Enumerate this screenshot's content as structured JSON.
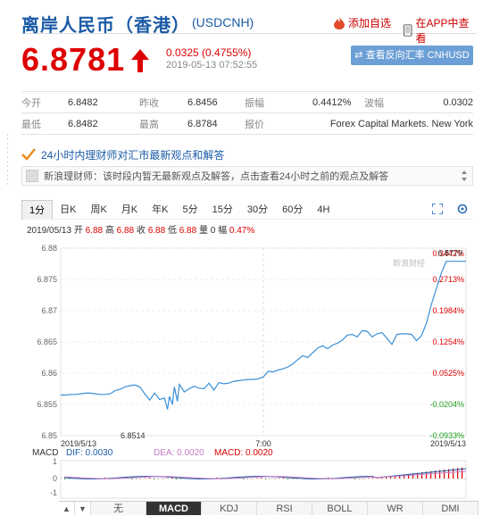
{
  "header": {
    "title": "离岸人民币（香港）",
    "symbol": "(USDCNH)",
    "add_watch": "添加自选",
    "view_in_app": "在APP中查看"
  },
  "quote": {
    "price": "6.8781",
    "change": "0.0325 (0.4755%)",
    "timestamp": "2019-05-13 07:52:55",
    "reverse_button": "查看反向汇率 CNHUSD",
    "up_color": "#dd0000"
  },
  "stats": {
    "row1": [
      {
        "label": "今开",
        "value": "6.8482"
      },
      {
        "label": "昨收",
        "value": "6.8456"
      },
      {
        "label": "振幅",
        "value": "0.4412%"
      },
      {
        "label": "波幅",
        "value": "0.0302"
      }
    ],
    "row2": [
      {
        "label": "最低",
        "value": "6.8482"
      },
      {
        "label": "最高",
        "value": "6.8784"
      },
      {
        "label": "报价",
        "value": "Forex Capital Markets. New York"
      }
    ]
  },
  "advice": {
    "text": "24小时内理财师对汇市最新观点和解答"
  },
  "news": {
    "text": "新浪理财师：该时段内暂无最新观点及解答，点击查看24小时之前的观点及解答"
  },
  "tabs": [
    "1分",
    "日K",
    "周K",
    "月K",
    "年K",
    "5分",
    "15分",
    "30分",
    "60分",
    "4H"
  ],
  "active_tab": "1分",
  "ohlc": {
    "date": "2019/05/13",
    "open_label": "开",
    "open": "6.88",
    "high_label": "高",
    "high": "6.88",
    "close_label": "收",
    "close": "6.88",
    "low_label": "低",
    "low": "6.88",
    "vol_label": "量",
    "vol": "0",
    "amp_label": "幅",
    "amp": "0.47%"
  },
  "watermark": "新浪财经",
  "chart_data": {
    "type": "line",
    "title": "",
    "y_ticks": [
      "6.88",
      "6.875",
      "6.87",
      "6.865",
      "6.86",
      "6.855",
      "6.85"
    ],
    "pct_ticks": [
      "0.3442%",
      "0.2713%",
      "0.1984%",
      "0.1254%",
      "0.0525%",
      "-0.0204%",
      "-0.0933%"
    ],
    "ylim": [
      6.85,
      6.88
    ],
    "x_labels": [
      "2019/5/13",
      "7:00",
      "2019/5/13"
    ],
    "max_label": "6.8779",
    "min_label": "6.8514",
    "series": [
      {
        "color": "#3b8fd6",
        "x": [
          0,
          5,
          10,
          15,
          20,
          25,
          30,
          35,
          40,
          45,
          50,
          55,
          60,
          65,
          70,
          75,
          80,
          85,
          90,
          95,
          100,
          105,
          108,
          110,
          113,
          115,
          118,
          120,
          125,
          130,
          135,
          140,
          145,
          150,
          155,
          160,
          165,
          170,
          175,
          180,
          185,
          190,
          195,
          200,
          205,
          210,
          215,
          220,
          225,
          230,
          235,
          240,
          245,
          250,
          255,
          260,
          265,
          270,
          275,
          280,
          285,
          290,
          295,
          300,
          305,
          310,
          315,
          320,
          325,
          330,
          335,
          340,
          345,
          350,
          355,
          360,
          365,
          370,
          375,
          380,
          385,
          390,
          395,
          400,
          405,
          410
        ],
        "y": [
          6.8565,
          6.8565,
          6.8566,
          6.8566,
          6.8567,
          6.8568,
          6.8568,
          6.8567,
          6.8566,
          6.8566,
          6.8567,
          6.8572,
          6.8574,
          6.8578,
          6.858,
          6.8581,
          6.8578,
          6.8567,
          6.8557,
          6.8568,
          6.8558,
          6.856,
          6.8542,
          6.8563,
          6.855,
          6.8578,
          6.8555,
          6.8582,
          6.857,
          6.8575,
          6.8579,
          6.8576,
          6.8575,
          6.8584,
          6.8573,
          6.8585,
          6.8583,
          6.8584,
          6.8587,
          6.8588,
          6.8589,
          6.859,
          6.859,
          6.8591,
          6.8594,
          6.8603,
          6.8602,
          6.8605,
          6.8607,
          6.861,
          6.8615,
          6.8622,
          6.8628,
          6.8625,
          6.8633,
          6.864,
          6.8644,
          6.8639,
          6.8645,
          6.8648,
          6.8653,
          6.8661,
          6.8662,
          6.8658,
          6.8668,
          6.8667,
          6.8658,
          6.8663,
          6.8665,
          6.8656,
          6.8646,
          6.8662,
          6.8663,
          6.8663,
          6.8662,
          6.8652,
          6.866,
          6.868,
          6.871,
          6.8735,
          6.876,
          6.8779,
          6.8779,
          6.8779,
          6.8779,
          6.8779
        ]
      }
    ]
  },
  "macd": {
    "label": "MACD",
    "dif_label": "DIF:",
    "dif": "0.0030",
    "dea_label": "DEA:",
    "dea": "0.0020",
    "macd_label": "MACD:",
    "macd": "0.0020",
    "y_labels": [
      "1",
      "0",
      "-1"
    ]
  },
  "bottom_tabs": [
    "无",
    "MACD",
    "KDJ",
    "RSI",
    "BOLL",
    "WR",
    "DMI"
  ],
  "bottom_active": "MACD"
}
